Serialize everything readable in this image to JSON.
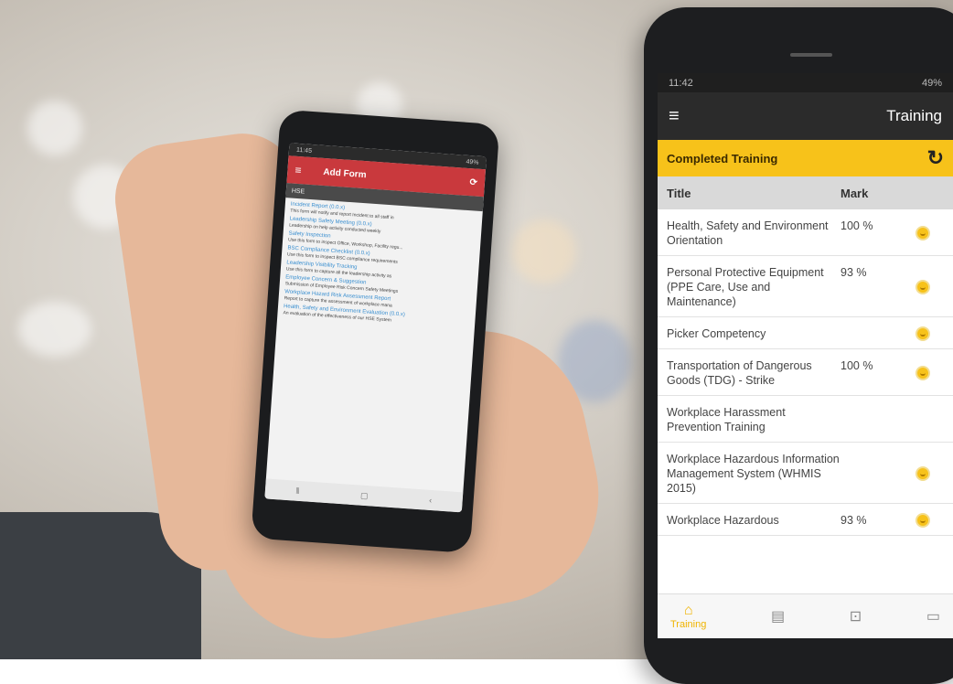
{
  "left_phone": {
    "status_time": "11:45",
    "status_right": "49%",
    "appbar_title": "Add Form",
    "section": "HSE",
    "items": [
      {
        "title": "Incident Report (0.0.x)",
        "desc": "This form will notify and report Incident to all staff in"
      },
      {
        "title": "Leadership Safety Meeting (0.0.x)",
        "desc": "Leadership on help activity conducted weekly"
      },
      {
        "title": "Safety Inspection",
        "desc": "Use this form to inspect Office, Workshop, Facility regu..."
      },
      {
        "title": "BSC Compliance Checklist (0.0.x)",
        "desc": "Use this form to inspect BSC compliance requirements"
      },
      {
        "title": "Leadership Visibility Tracking",
        "desc": "Use this form to capture all the leadership activity as"
      },
      {
        "title": "Employee Concern & Suggestion",
        "desc": "Submission of Employee Risk Concern Safety Meetings"
      },
      {
        "title": "Workplace Hazard Risk Assessment Report",
        "desc": "Report to capture the assessment of workplace mana"
      },
      {
        "title": "Health, Safety and Environment Evaluation (0.0.x)",
        "desc": "An evaluation of the effectiveness of our HSE System"
      }
    ]
  },
  "right_phone": {
    "status_time": "11:42",
    "status_right": "49%",
    "appbar_title": "Training",
    "banner": "Completed Training",
    "columns": {
      "title": "Title",
      "mark": "Mark"
    },
    "rows": [
      {
        "title": "Health, Safety and Environment Orientation",
        "mark": "100 %",
        "medal": true
      },
      {
        "title": "Personal Protective Equipment (PPE Care, Use and Maintenance)",
        "mark": "93 %",
        "medal": true
      },
      {
        "title": "Picker Competency",
        "mark": "",
        "medal": true
      },
      {
        "title": "Transportation of Dangerous Goods (TDG) - Strike",
        "mark": "100 %",
        "medal": true
      },
      {
        "title": "Workplace Harassment Prevention Training",
        "mark": "",
        "medal": false
      },
      {
        "title": "Workplace Hazardous Information Management System (WHMIS 2015)",
        "mark": "",
        "medal": true
      },
      {
        "title": "Workplace Hazardous",
        "mark": "93 %",
        "medal": true
      }
    ],
    "nav": {
      "training": "Training"
    },
    "colors": {
      "accent": "#f7c21a",
      "appbar": "#2b2b2b"
    }
  }
}
